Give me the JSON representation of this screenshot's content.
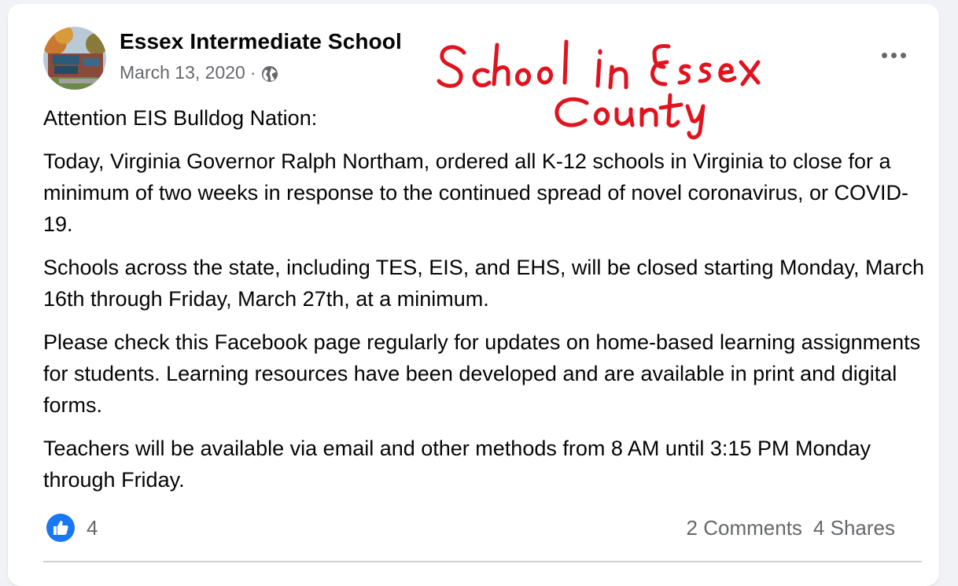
{
  "post": {
    "page_name": "Essex Intermediate School",
    "date": "March 13, 2020",
    "separator": "·",
    "privacy_icon": "globe-icon",
    "more_icon": "ellipsis-icon",
    "annotation_text": "School in Essex County",
    "annotation_color": "#e0141e",
    "paragraphs": [
      "Attention EIS Bulldog Nation:",
      "Today, Virginia Governor Ralph Northam, ordered all K-12 schools in Virginia to close for a minimum of two weeks in response to the continued spread of novel coronavirus, or COVID-19.",
      "Schools across the state, including TES, EIS, and EHS, will be closed starting Monday, March 16th through Friday, March 27th, at a minimum.",
      "Please check this Facebook page regularly for updates on home-based learning assignments for students. Learning resources have been developed and are available in print and digital forms.",
      "Teachers will be available via email and other methods from 8 AM until 3:15 PM Monday through Friday."
    ]
  },
  "reactions": {
    "icon": "thumbs-up-icon",
    "count": "4",
    "color": "#1877f2"
  },
  "stats": {
    "comments": "2 Comments",
    "shares": "4 Shares"
  }
}
